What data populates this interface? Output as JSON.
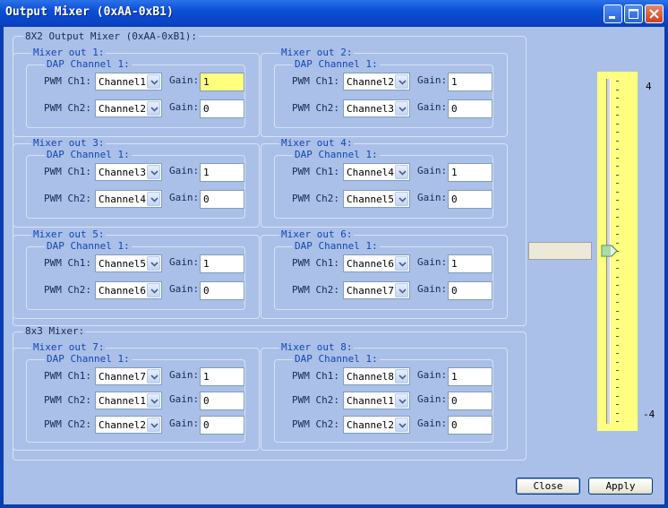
{
  "window": {
    "title": "Output Mixer (0xAA-0xB1)"
  },
  "groups": {
    "mixer_8x2": "8X2 Output Mixer (0xAA-0xB1):",
    "mixer_8x3": "8x3 Mixer:"
  },
  "labels": {
    "dap": "DAP Channel 1:",
    "pwm1": "PWM Ch1:",
    "pwm2": "PWM Ch2:",
    "gain": "Gain:"
  },
  "mixers": [
    {
      "title": "Mixer out 1:",
      "rows": [
        {
          "channel": "Channel1",
          "gain": "1"
        },
        {
          "channel": "Channel2",
          "gain": "0"
        }
      ]
    },
    {
      "title": "Mixer out 2:",
      "rows": [
        {
          "channel": "Channel2",
          "gain": "1"
        },
        {
          "channel": "Channel3",
          "gain": "0"
        }
      ]
    },
    {
      "title": "Mixer out 3:",
      "rows": [
        {
          "channel": "Channel3",
          "gain": "1"
        },
        {
          "channel": "Channel4",
          "gain": "0"
        }
      ]
    },
    {
      "title": "Mixer out 4:",
      "rows": [
        {
          "channel": "Channel4",
          "gain": "1"
        },
        {
          "channel": "Channel5",
          "gain": "0"
        }
      ]
    },
    {
      "title": "Mixer out 5:",
      "rows": [
        {
          "channel": "Channel5",
          "gain": "1"
        },
        {
          "channel": "Channel6",
          "gain": "0"
        }
      ]
    },
    {
      "title": "Mixer out 6:",
      "rows": [
        {
          "channel": "Channel6",
          "gain": "1"
        },
        {
          "channel": "Channel7",
          "gain": "0"
        }
      ]
    },
    {
      "title": "Mixer out 7:",
      "rows": [
        {
          "channel": "Channel7",
          "gain": "1"
        },
        {
          "channel": "Channel1",
          "gain": "0"
        },
        {
          "channel": "Channel2",
          "gain": "0"
        }
      ]
    },
    {
      "title": "Mixer out 8:",
      "rows": [
        {
          "channel": "Channel8",
          "gain": "1"
        },
        {
          "channel": "Channel1",
          "gain": "0"
        },
        {
          "channel": "Channel2",
          "gain": "0"
        }
      ]
    }
  ],
  "slider": {
    "max_label": "4",
    "min_label": "-4",
    "value": 0
  },
  "buttons": {
    "close": "Close",
    "apply": "Apply"
  },
  "colors": {
    "title_bar": "#0b4ed6",
    "client_bg": "#aac0e8",
    "highlight": "#ffff80",
    "group_label": "#1446b4"
  }
}
